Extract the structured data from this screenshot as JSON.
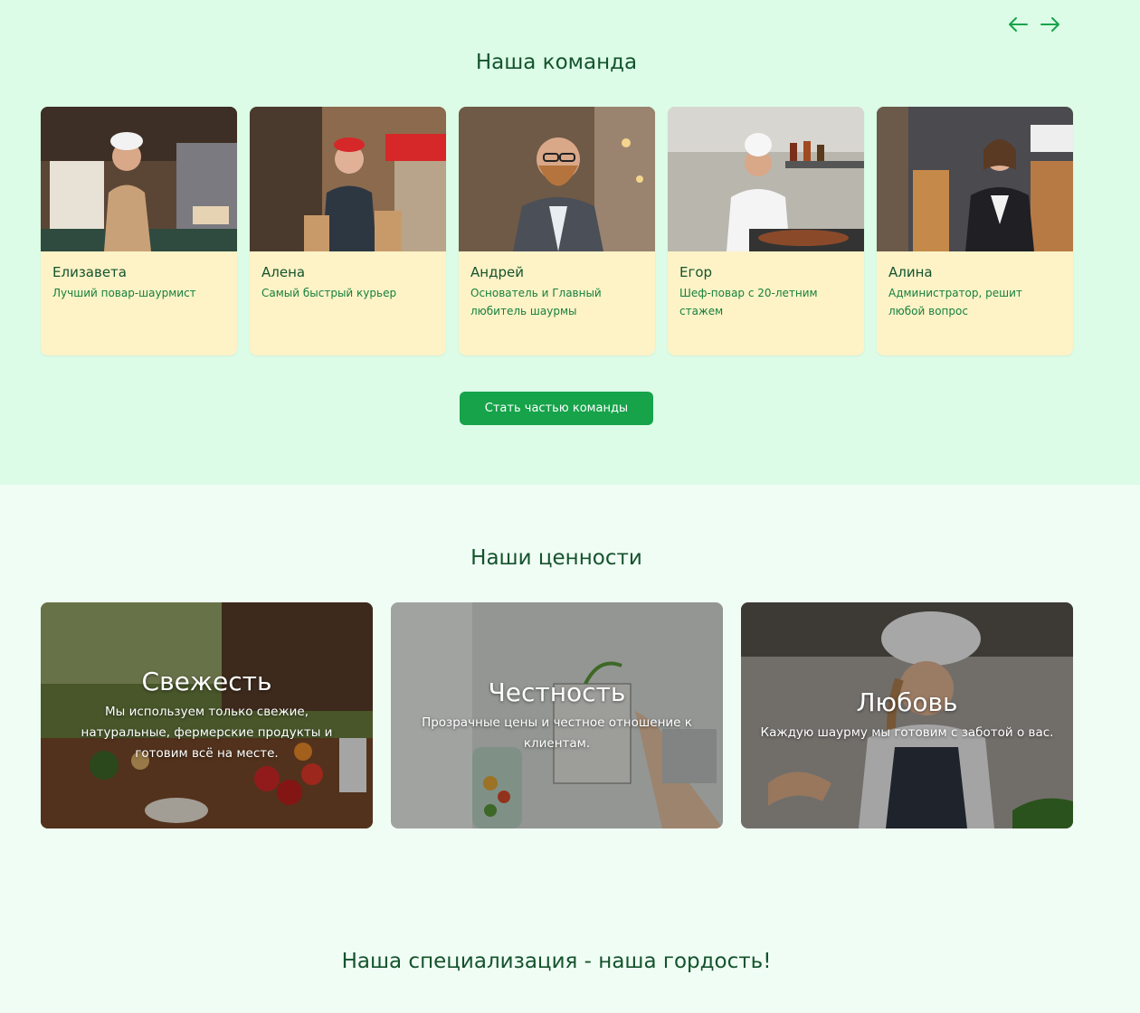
{
  "team": {
    "title": "Наша команда",
    "prev_icon": "arrow-left-icon",
    "next_icon": "arrow-right-icon",
    "members": [
      {
        "name": "Елизавета",
        "role": "Лучший повар-шаурмист"
      },
      {
        "name": "Алена",
        "role": "Самый быстрый курьер"
      },
      {
        "name": "Андрей",
        "role": "Основатель и Главный любитель шаурмы"
      },
      {
        "name": "Егор",
        "role": "Шеф-повар с 20-летним стажем"
      },
      {
        "name": "Алина",
        "role": "Администратор, решит любой вопрос"
      }
    ],
    "join_label": "Стать частью команды"
  },
  "values": {
    "title": "Наши ценности",
    "items": [
      {
        "title": "Свежесть",
        "desc": "Мы используем только свежие, натуральные, фермерские продукты и готовим всё на месте."
      },
      {
        "title": "Честность",
        "desc": "Прозрачные цены и честное отношение к клиентам."
      },
      {
        "title": "Любовь",
        "desc": "Каждую шаурму мы готовим с заботой о вас."
      }
    ]
  },
  "specialization": {
    "title": "Наша специализация - наша гордость!"
  },
  "colors": {
    "team_bg": "#dcfce7",
    "page_bg": "#f0fdf4",
    "card_bg": "#fef3c7",
    "accent": "#16a34a",
    "heading": "#14532d"
  }
}
